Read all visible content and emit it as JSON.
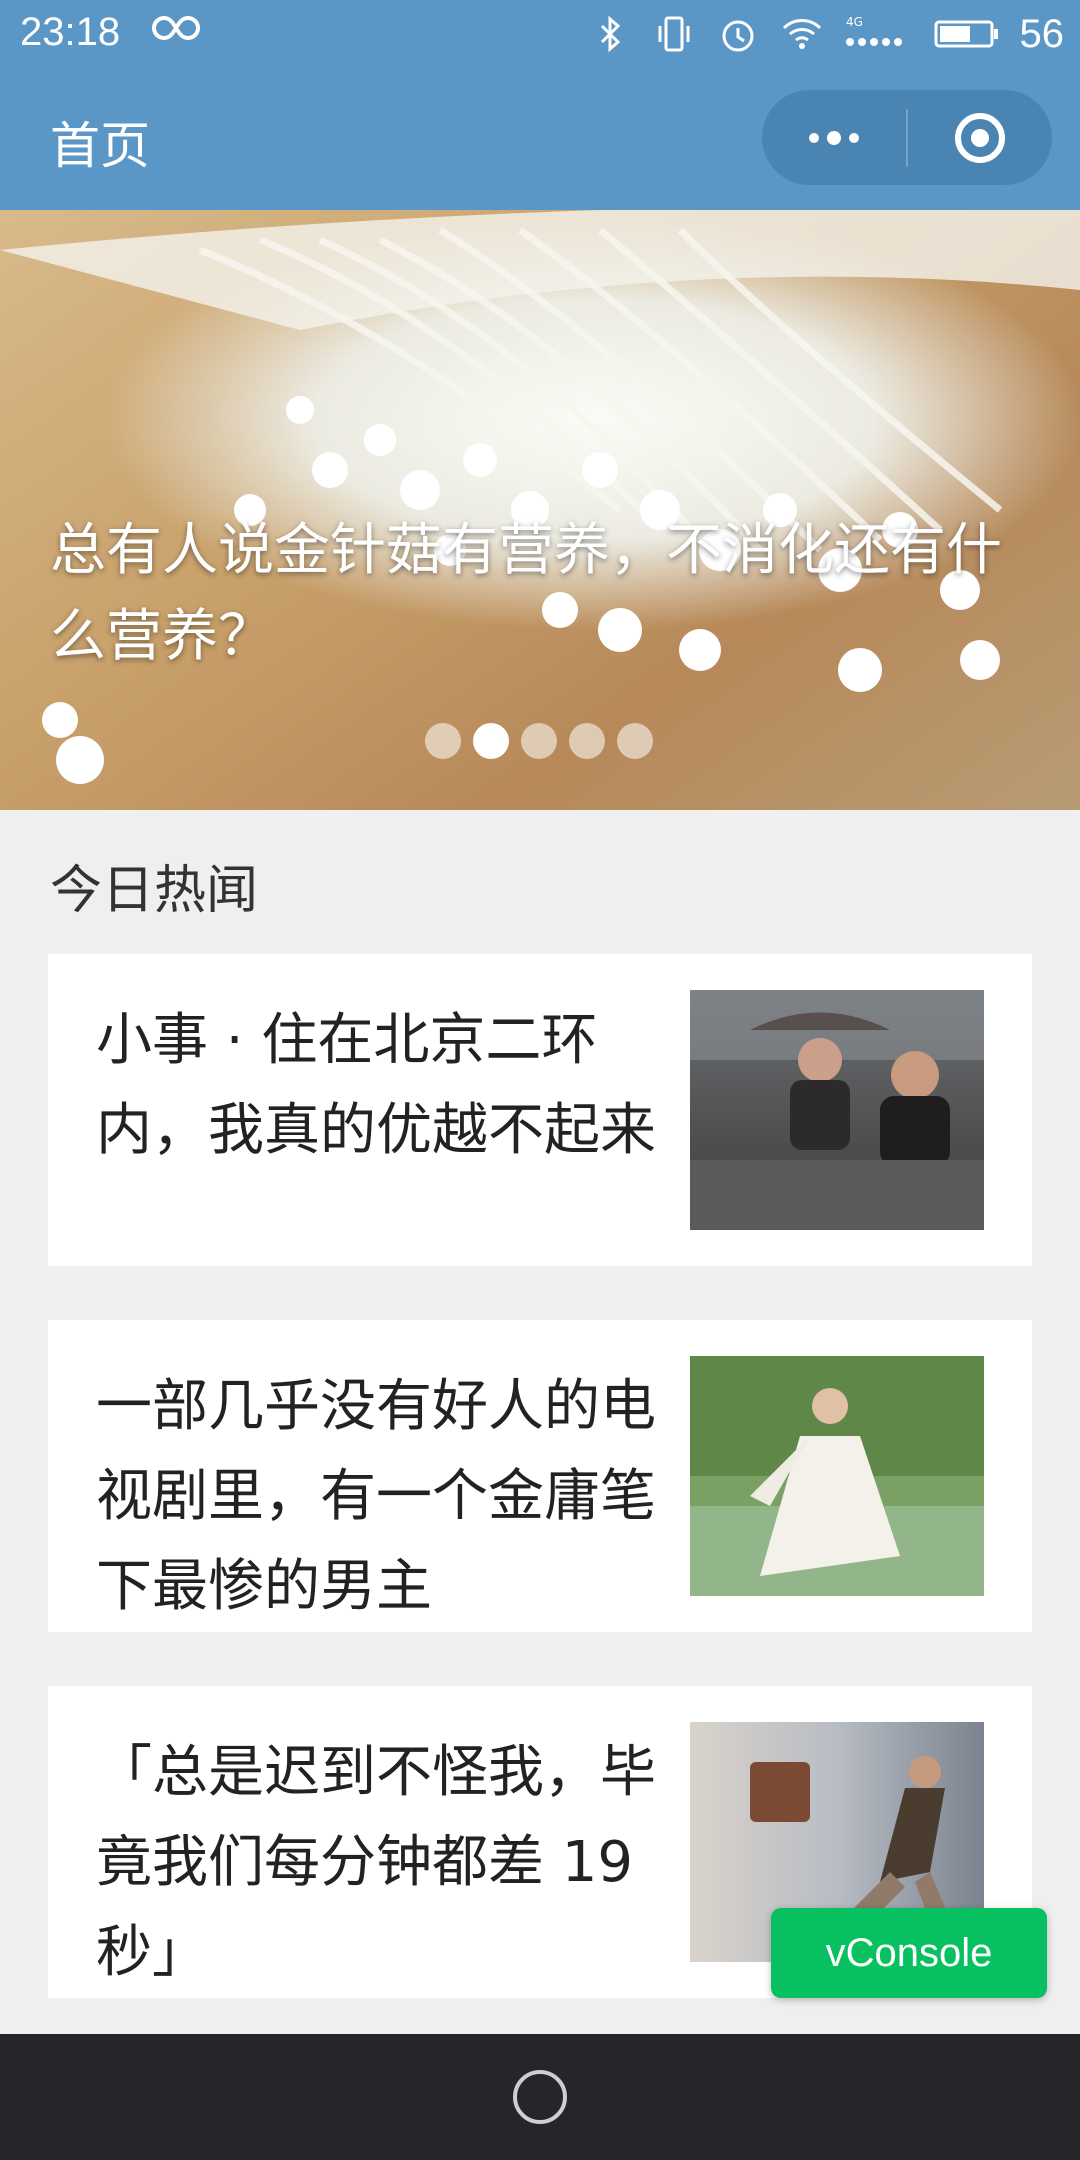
{
  "status_bar": {
    "time": "23:18",
    "battery_level": "56",
    "network_label": "4G",
    "icons": [
      "link-icon",
      "bluetooth-icon",
      "vibrate-icon",
      "alarm-icon",
      "wifi-icon",
      "signal-icon",
      "battery-icon"
    ]
  },
  "header": {
    "title": "首页",
    "capsule": {
      "more_icon": "more-dots-icon",
      "close_icon": "target-circle-icon"
    }
  },
  "banner": {
    "title": "总有人说金针菇有营养，不消化还有什么营养？",
    "dots_total": 5,
    "active_dot": 2
  },
  "section": {
    "title": "今日热闻"
  },
  "articles": [
    {
      "title": "小事 · 住在北京二环内，我真的优越不起来"
    },
    {
      "title": "一部几乎没有好人的电视剧里，有一个金庸笔下最惨的男主"
    },
    {
      "title": "「总是迟到不怪我，毕竟我们每分钟都差 19 秒」"
    }
  ],
  "vconsole": {
    "label": "vConsole"
  },
  "colors": {
    "header": "#5a96c6",
    "capsule": "#4a84b2",
    "vconsole": "#07c160",
    "navbar": "#242629"
  }
}
